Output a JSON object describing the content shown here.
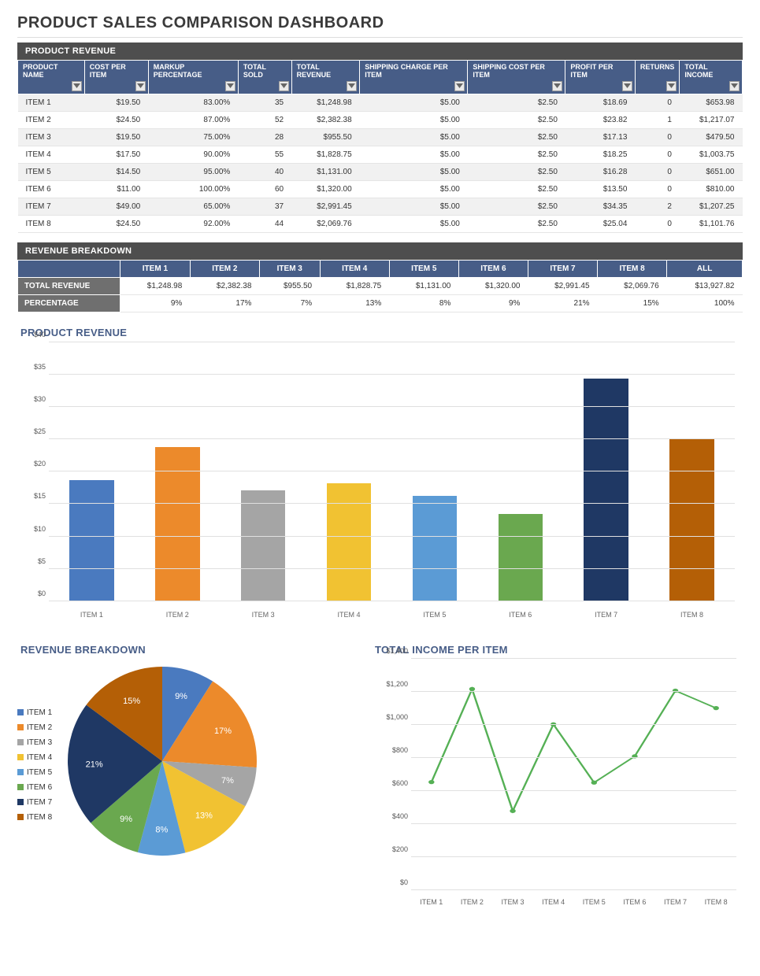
{
  "title": "PRODUCT SALES COMPARISON DASHBOARD",
  "palette": [
    "#4a7abf",
    "#ec8a2b",
    "#a5a5a5",
    "#f1c232",
    "#5b9bd5",
    "#6aa84f",
    "#1f3864",
    "#b45f06"
  ],
  "table1": {
    "title": "PRODUCT REVENUE",
    "columns": [
      "PRODUCT NAME",
      "COST PER ITEM",
      "MARKUP PERCENTAGE",
      "TOTAL SOLD",
      "TOTAL REVENUE",
      "SHIPPING CHARGE PER ITEM",
      "SHIPPING COST PER ITEM",
      "PROFIT PER ITEM",
      "RETURNS",
      "TOTAL INCOME"
    ],
    "rows": [
      [
        "ITEM 1",
        "$19.50",
        "83.00%",
        "35",
        "$1,248.98",
        "$5.00",
        "$2.50",
        "$18.69",
        "0",
        "$653.98"
      ],
      [
        "ITEM 2",
        "$24.50",
        "87.00%",
        "52",
        "$2,382.38",
        "$5.00",
        "$2.50",
        "$23.82",
        "1",
        "$1,217.07"
      ],
      [
        "ITEM 3",
        "$19.50",
        "75.00%",
        "28",
        "$955.50",
        "$5.00",
        "$2.50",
        "$17.13",
        "0",
        "$479.50"
      ],
      [
        "ITEM 4",
        "$17.50",
        "90.00%",
        "55",
        "$1,828.75",
        "$5.00",
        "$2.50",
        "$18.25",
        "0",
        "$1,003.75"
      ],
      [
        "ITEM 5",
        "$14.50",
        "95.00%",
        "40",
        "$1,131.00",
        "$5.00",
        "$2.50",
        "$16.28",
        "0",
        "$651.00"
      ],
      [
        "ITEM 6",
        "$11.00",
        "100.00%",
        "60",
        "$1,320.00",
        "$5.00",
        "$2.50",
        "$13.50",
        "0",
        "$810.00"
      ],
      [
        "ITEM 7",
        "$49.00",
        "65.00%",
        "37",
        "$2,991.45",
        "$5.00",
        "$2.50",
        "$34.35",
        "2",
        "$1,207.25"
      ],
      [
        "ITEM 8",
        "$24.50",
        "92.00%",
        "44",
        "$2,069.76",
        "$5.00",
        "$2.50",
        "$25.04",
        "0",
        "$1,101.76"
      ]
    ]
  },
  "table2": {
    "title": "REVENUE BREAKDOWN",
    "columns": [
      "ITEM 1",
      "ITEM 2",
      "ITEM 3",
      "ITEM 4",
      "ITEM 5",
      "ITEM 6",
      "ITEM 7",
      "ITEM 8",
      "ALL"
    ],
    "row_labels": [
      "TOTAL REVENUE",
      "PERCENTAGE"
    ],
    "rows": [
      [
        "$1,248.98",
        "$2,382.38",
        "$955.50",
        "$1,828.75",
        "$1,131.00",
        "$1,320.00",
        "$2,991.45",
        "$2,069.76",
        "$13,927.82"
      ],
      [
        "9%",
        "17%",
        "7%",
        "13%",
        "8%",
        "9%",
        "21%",
        "15%",
        "100%"
      ]
    ]
  },
  "chart_data": [
    {
      "type": "bar",
      "title": "PRODUCT REVENUE",
      "categories": [
        "ITEM 1",
        "ITEM 2",
        "ITEM 3",
        "ITEM 4",
        "ITEM 5",
        "ITEM 6",
        "ITEM 7",
        "ITEM 8"
      ],
      "values": [
        18.69,
        23.82,
        17.13,
        18.25,
        16.28,
        13.5,
        34.35,
        25.04
      ],
      "ylabel": "",
      "ylim": [
        0,
        40
      ],
      "yticks": [
        "$0",
        "$5",
        "$10",
        "$15",
        "$20",
        "$25",
        "$30",
        "$35",
        "$40"
      ]
    },
    {
      "type": "pie",
      "title": "REVENUE BREAKDOWN",
      "categories": [
        "ITEM 1",
        "ITEM 2",
        "ITEM 3",
        "ITEM 4",
        "ITEM 5",
        "ITEM 6",
        "ITEM 7",
        "ITEM 8"
      ],
      "percent_labels": [
        "9%",
        "17%",
        "7%",
        "13%",
        "8%",
        "9%",
        "21%",
        "15%"
      ],
      "values": [
        1248.98,
        2382.38,
        955.5,
        1828.75,
        1131.0,
        1320.0,
        2991.45,
        2069.76
      ]
    },
    {
      "type": "line",
      "title": "TOTAL INCOME PER ITEM",
      "categories": [
        "ITEM 1",
        "ITEM 2",
        "ITEM 3",
        "ITEM 4",
        "ITEM 5",
        "ITEM 6",
        "ITEM 7",
        "ITEM 8"
      ],
      "values": [
        653.98,
        1217.07,
        479.5,
        1003.75,
        651.0,
        810.0,
        1207.25,
        1101.76
      ],
      "ylim": [
        0,
        1400
      ],
      "yticks": [
        "$0",
        "$200",
        "$400",
        "$600",
        "$800",
        "$1,000",
        "$1,200",
        "$1,400"
      ]
    }
  ]
}
